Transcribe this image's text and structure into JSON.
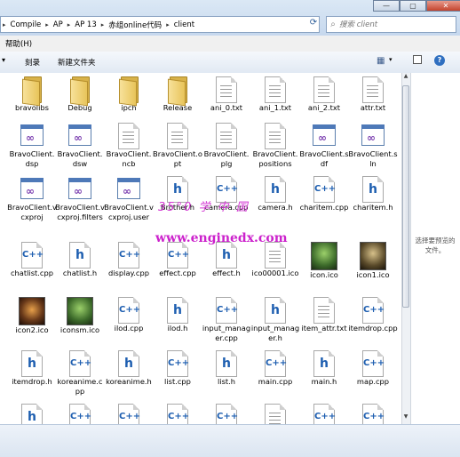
{
  "window": {
    "minimize_label": "—",
    "maximize_label": "▢",
    "close_label": "✕"
  },
  "address": {
    "crumbs": [
      "Compile",
      "AP",
      "AP 13",
      "赤组online代码",
      "client"
    ],
    "separator": "▸",
    "refresh_icon": "refresh-icon"
  },
  "search": {
    "placeholder": "搜索 client",
    "icon": "search-icon"
  },
  "menu": {
    "help": "帮助(H)"
  },
  "toolbar": {
    "burn": "刻录",
    "new_folder": "新建文件夹",
    "view_icon": "view-icon",
    "help_icon": "?"
  },
  "files": [
    {
      "name": "bravolibs",
      "type": "folder"
    },
    {
      "name": "Debug",
      "type": "folder"
    },
    {
      "name": "ipch",
      "type": "folder"
    },
    {
      "name": "Release",
      "type": "folder"
    },
    {
      "name": "ani_0.txt",
      "type": "doc"
    },
    {
      "name": "ani_1.txt",
      "type": "doc"
    },
    {
      "name": "ani_2.txt",
      "type": "doc"
    },
    {
      "name": "attr.txt",
      "type": "doc"
    },
    {
      "name": "BravoClient.dsp",
      "type": "vs"
    },
    {
      "name": "BravoClient.dsw",
      "type": "vs"
    },
    {
      "name": "BravoClient.ncb",
      "type": "doc"
    },
    {
      "name": "BravoClient.opt",
      "type": "doc"
    },
    {
      "name": "BravoClient.plg",
      "type": "doc"
    },
    {
      "name": "BravoClient.positions",
      "type": "doc"
    },
    {
      "name": "BravoClient.sdf",
      "type": "vs"
    },
    {
      "name": "BravoClient.sln",
      "type": "vs"
    },
    {
      "name": "BravoClient.vcxproj",
      "type": "vs"
    },
    {
      "name": "BravoClient.vcxproj.filters",
      "type": "vs"
    },
    {
      "name": "BravoClient.vcxproj.user",
      "type": "vs"
    },
    {
      "name": "Brother.h",
      "type": "h"
    },
    {
      "name": "camera.cpp",
      "type": "cpp"
    },
    {
      "name": "camera.h",
      "type": "h"
    },
    {
      "name": "charitem.cpp",
      "type": "cpp"
    },
    {
      "name": "charitem.h",
      "type": "h"
    },
    {
      "name": "chatlist.cpp",
      "type": "cpp"
    },
    {
      "name": "chatlist.h",
      "type": "h"
    },
    {
      "name": "display.cpp",
      "type": "cpp"
    },
    {
      "name": "effect.cpp",
      "type": "cpp"
    },
    {
      "name": "effect.h",
      "type": "h"
    },
    {
      "name": "ico00001.ico",
      "type": "doc"
    },
    {
      "name": "icon.ico",
      "type": "thumb"
    },
    {
      "name": "icon1.ico",
      "type": "thumb"
    },
    {
      "name": "icon2.ico",
      "type": "thumb"
    },
    {
      "name": "iconsm.ico",
      "type": "thumb"
    },
    {
      "name": "ilod.cpp",
      "type": "cpp"
    },
    {
      "name": "ilod.h",
      "type": "h"
    },
    {
      "name": "input_manager.cpp",
      "type": "cpp"
    },
    {
      "name": "input_manager.h",
      "type": "h"
    },
    {
      "name": "item_attr.txt",
      "type": "doc"
    },
    {
      "name": "itemdrop.cpp",
      "type": "cpp"
    },
    {
      "name": "itemdrop.h",
      "type": "h"
    },
    {
      "name": "koreanime.cpp",
      "type": "cpp"
    },
    {
      "name": "koreanime.h",
      "type": "h"
    },
    {
      "name": "list.cpp",
      "type": "cpp"
    },
    {
      "name": "list.h",
      "type": "h"
    },
    {
      "name": "main.cpp",
      "type": "cpp"
    },
    {
      "name": "main.h",
      "type": "h"
    },
    {
      "name": "map.cpp",
      "type": "cpp"
    },
    {
      "name": "",
      "type": "h"
    },
    {
      "name": "",
      "type": "cpp"
    },
    {
      "name": "",
      "type": "cpp"
    },
    {
      "name": "",
      "type": "cpp"
    },
    {
      "name": "",
      "type": "cpp"
    },
    {
      "name": "",
      "type": "doc"
    },
    {
      "name": "",
      "type": "cpp"
    },
    {
      "name": "",
      "type": "cpp"
    }
  ],
  "preview": {
    "message": "选择要预览的文件。"
  },
  "watermark": {
    "line1": "35°0 学 中 国",
    "line2": "www.enginedx.com"
  }
}
